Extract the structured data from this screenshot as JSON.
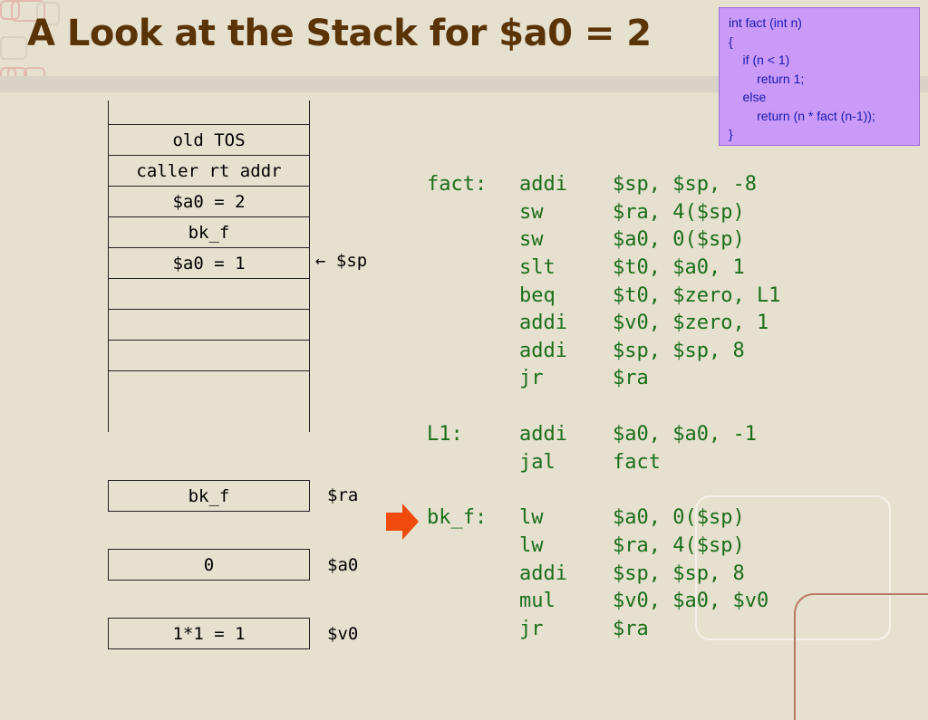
{
  "slide_title": "A Look at the Stack for $a0 = 2",
  "c_code": [
    "int fact (int n)",
    "{",
    "    if (n < 1)",
    "        return 1;",
    "    else",
    "        return (n * fact (n-1));",
    "}"
  ],
  "stack": {
    "slots": [
      "",
      "old TOS",
      "caller rt addr",
      "$a0 = 2",
      "bk_f",
      "$a0 = 1",
      "",
      "",
      ""
    ],
    "sp_label": "← $sp"
  },
  "registers": [
    {
      "value": "bk_f",
      "name": "$ra"
    },
    {
      "value": "0",
      "name": "$a0"
    },
    {
      "value": "1*1 = 1",
      "name": "$v0"
    }
  ],
  "assembly": [
    {
      "label": "fact:",
      "op": "addi",
      "args": "$sp, $sp, -8"
    },
    {
      "label": "",
      "op": "sw",
      "args": "$ra, 4($sp)"
    },
    {
      "label": "",
      "op": "sw",
      "args": "$a0, 0($sp)"
    },
    {
      "label": "",
      "op": "slt",
      "args": "$t0, $a0, 1"
    },
    {
      "label": "",
      "op": "beq",
      "args": "$t0, $zero, L1"
    },
    {
      "label": "",
      "op": "addi",
      "args": "$v0, $zero, 1"
    },
    {
      "label": "",
      "op": "addi",
      "args": "$sp, $sp, 8"
    },
    {
      "label": "",
      "op": "jr",
      "args": "$ra"
    },
    {
      "label": "L1:",
      "op": "addi",
      "args": "$a0, $a0, -1"
    },
    {
      "label": "",
      "op": "jal",
      "args": "fact"
    },
    {
      "label": "bk_f:",
      "op": "lw",
      "args": "$a0, 0($sp)"
    },
    {
      "label": "",
      "op": "lw",
      "args": "$ra, 4($sp)"
    },
    {
      "label": "",
      "op": "addi",
      "args": "$sp, $sp, 8"
    },
    {
      "label": "",
      "op": "mul",
      "args": "$v0, $a0, $v0"
    },
    {
      "label": "",
      "op": "jr",
      "args": "$ra"
    }
  ],
  "colors": {
    "title": "#5a3306",
    "code": "#1b6e1b",
    "code_box": "#c99af8",
    "arrow": "#f04a0c"
  }
}
